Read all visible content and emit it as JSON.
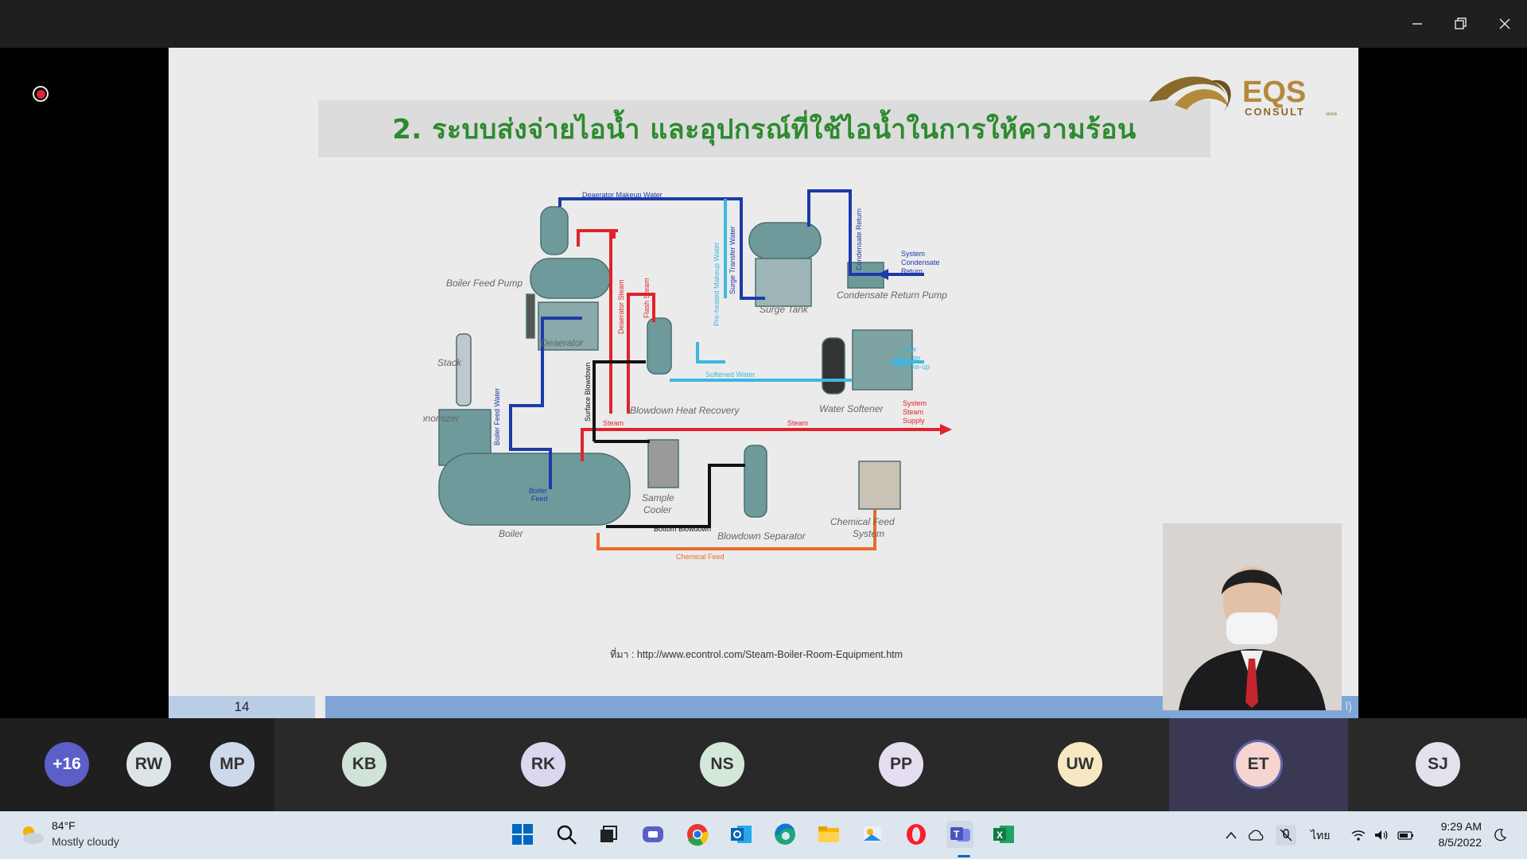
{
  "window": {
    "minimize": "minimize",
    "maximize": "restore",
    "close": "close"
  },
  "slide": {
    "title": "2. ระบบส่งจ่ายไอน้ำ และอุปกรณ์ที่ใช้ไอน้ำในการให้ความร้อน",
    "logo_main": "EQS",
    "logo_sub": "CONSULT",
    "logo_since": "since",
    "source": "ที่มา : http://www.econtrol.com/Steam-Boiler-Room-Equipment.htm",
    "page_number": "14",
    "bottom_bar_text": "l)",
    "diagram": {
      "deaerator_makeup_water": "Deaerator Makeup Water",
      "boiler_feed_pump": "Boiler Feed Pump",
      "deaerator": "Deaerator",
      "surge_tank": "Surge Tank",
      "condensate_return_pump": "Condensate Return Pump",
      "system_condensate_return": [
        "System",
        "Condensate",
        "Return"
      ],
      "condensate_return": "Condensate Return",
      "surge_transfer_water": "Surge Transfer Water",
      "preheated_makeup_water": "Pre-heated Makeup Water",
      "flash_steam": "Flash Steam",
      "deaerator_steam": "Deaerator Steam",
      "raw_water_makeup": [
        "Raw",
        "Water",
        "Make-up"
      ],
      "stack": "Stack",
      "boiler_feed_water": "Boiler Feed Water",
      "surface_blowdown": "Surface Blowdown",
      "softened_water": "Softened Water",
      "blowdown_heat_recovery": "Blowdown Heat Recovery",
      "water_softener": "Water Softener",
      "system_steam_supply": [
        "System",
        "Steam",
        "Supply"
      ],
      "economizer": "Economizer",
      "steam_left": "Steam",
      "steam_right": "Steam",
      "boiler_feed": [
        "Boiler",
        "Feed"
      ],
      "sample_cooler": [
        "Sample",
        "Cooler"
      ],
      "boiler": "Boiler",
      "bottom_blowdown": "Bottom Blowdown",
      "blowdown_separator": "Blowdown Separator",
      "chemical_feed_system": [
        "Chemical Feed",
        "System"
      ],
      "chemical_feed": "Chemical Feed"
    }
  },
  "participants": [
    {
      "initials": "+16",
      "bg": "#5b5fc7",
      "fg": "#ffffff"
    },
    {
      "initials": "RW",
      "bg": "#dde4e8",
      "fg": "#333333"
    },
    {
      "initials": "MP",
      "bg": "#cdd9ea",
      "fg": "#333333"
    },
    {
      "initials": "KB",
      "bg": "#cfe3d8",
      "fg": "#333333"
    },
    {
      "initials": "RK",
      "bg": "#dcd7ef",
      "fg": "#333333"
    },
    {
      "initials": "NS",
      "bg": "#d4e8da",
      "fg": "#333333"
    },
    {
      "initials": "PP",
      "bg": "#e4def0",
      "fg": "#333333"
    },
    {
      "initials": "UW",
      "bg": "#f7e8c3",
      "fg": "#333333"
    },
    {
      "initials": "ET",
      "bg": "#f6d4d0",
      "fg": "#333333"
    },
    {
      "initials": "SJ",
      "bg": "#e4e0ec",
      "fg": "#333333"
    }
  ],
  "taskbar": {
    "weather_temp": "84°F",
    "weather_desc": "Mostly cloudy",
    "language": "ไทย",
    "time": "9:29 AM",
    "date": "8/5/2022",
    "apps": [
      "start-icon",
      "search-icon",
      "task-view-icon",
      "teams-chat-icon",
      "chrome-icon",
      "outlook-icon",
      "edge-icon",
      "file-explorer-icon",
      "photos-icon",
      "opera-icon",
      "teams-icon",
      "excel-icon"
    ]
  }
}
